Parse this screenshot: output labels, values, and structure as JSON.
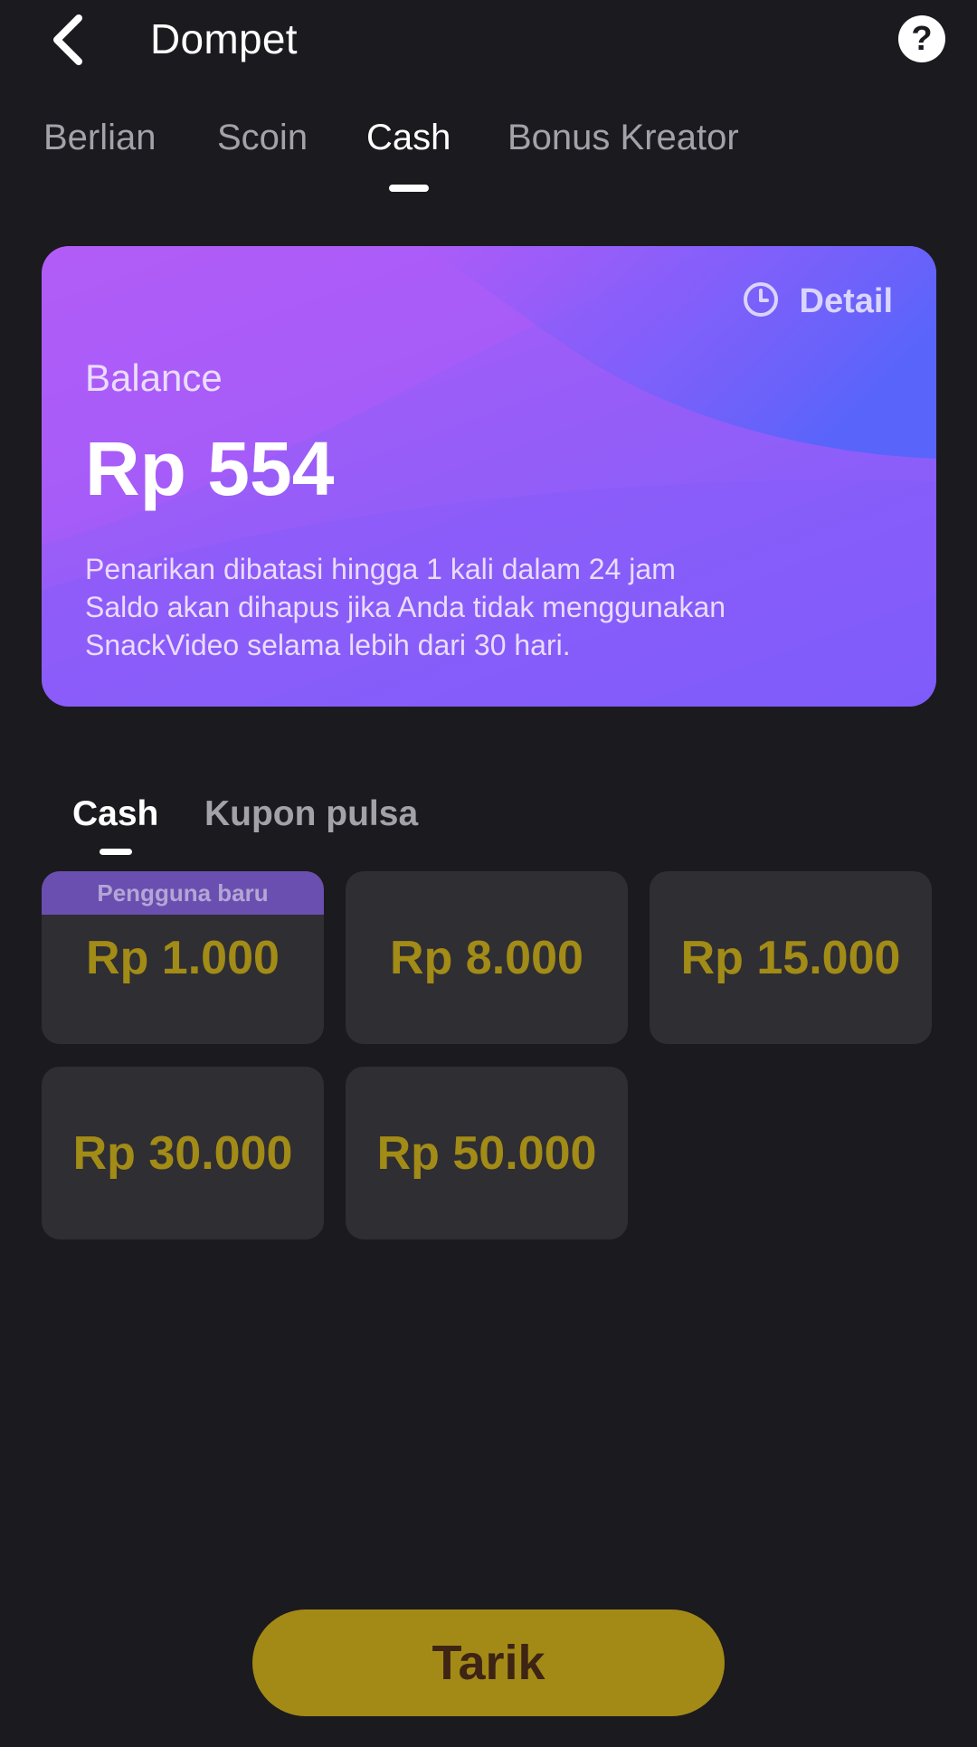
{
  "header": {
    "title": "Dompet",
    "back_icon": "chevron-left-icon",
    "help_icon": "question-mark-icon",
    "help_glyph": "?"
  },
  "top_tabs": [
    {
      "label": "Berlian",
      "active": false
    },
    {
      "label": "Scoin",
      "active": false
    },
    {
      "label": "Cash",
      "active": true
    },
    {
      "label": "Bonus Kreator",
      "active": false
    }
  ],
  "balance_card": {
    "detail_label": "Detail",
    "detail_icon": "clock-icon",
    "balance_label": "Balance",
    "balance_value": "Rp 554",
    "notes": [
      "Penarikan dibatasi hingga 1 kali dalam 24 jam",
      "Saldo akan dihapus jika Anda tidak menggunakan",
      "SnackVideo selama lebih dari 30 hari."
    ]
  },
  "sub_tabs": [
    {
      "label": "Cash",
      "active": true
    },
    {
      "label": "Kupon pulsa",
      "active": false
    }
  ],
  "amounts": [
    {
      "value": "Rp 1.000",
      "badge": "Pengguna baru"
    },
    {
      "value": "Rp 8.000"
    },
    {
      "value": "Rp 15.000"
    },
    {
      "value": "Rp 30.000"
    },
    {
      "value": "Rp 50.000"
    }
  ],
  "withdraw_button": {
    "label": "Tarik"
  },
  "colors": {
    "background": "#1b1a1f",
    "card_tile": "#2f2e33",
    "gold": "#a38a16",
    "badge": "#6a4fb0",
    "card_gradient_start": "#b25cf7",
    "card_gradient_end": "#4f6cfb"
  }
}
